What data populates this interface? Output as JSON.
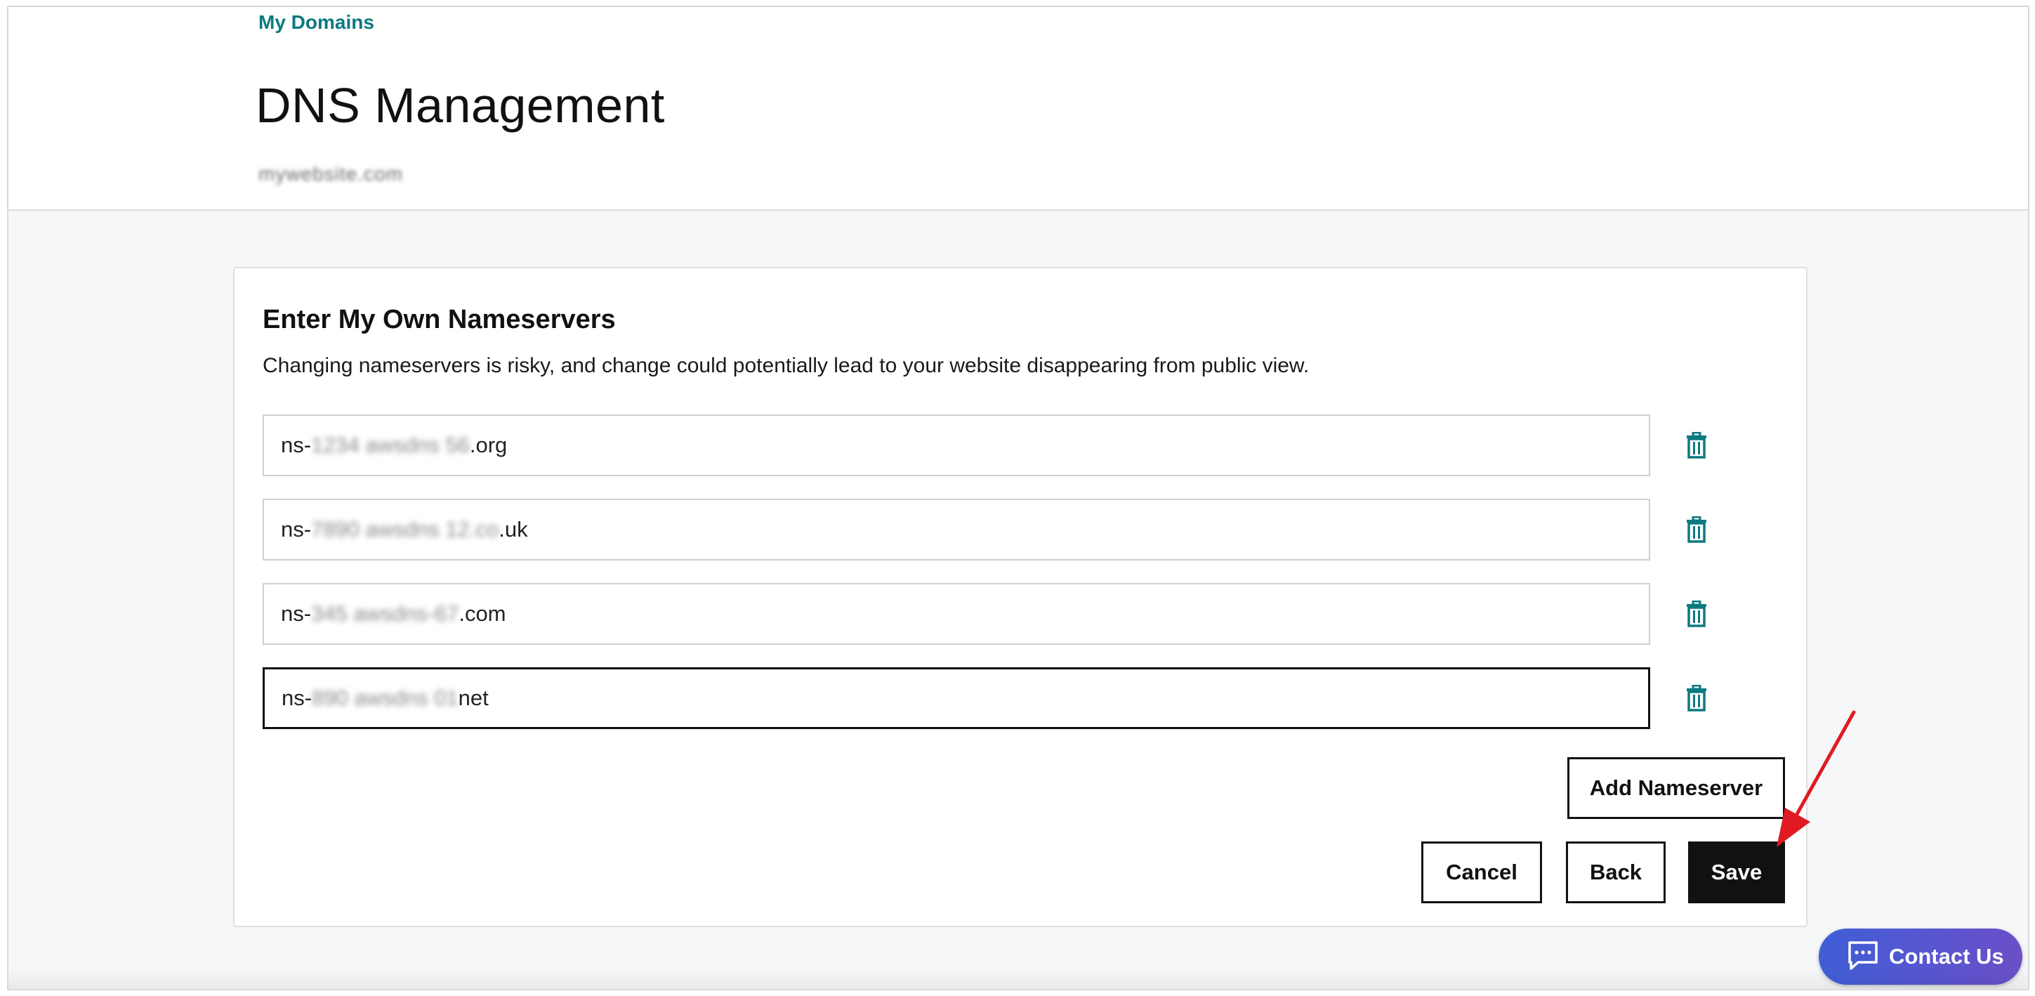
{
  "header": {
    "breadcrumb": "My Domains",
    "title": "DNS Management",
    "domain": "mywebsite.com"
  },
  "nameservers_card": {
    "title": "Enter My Own Nameservers",
    "description": "Changing nameservers is risky, and change could potentially lead to your website disappearing from public view.",
    "entries": [
      {
        "prefix": "ns-",
        "hidden": "1234 awsdns 56",
        "suffix": ".org"
      },
      {
        "prefix": "ns-",
        "hidden": "7890 awsdns 12.co",
        "suffix": ".uk"
      },
      {
        "prefix": "ns-",
        "hidden": "345 awsdns-67",
        "suffix": ".com"
      },
      {
        "prefix": "ns-",
        "hidden": "890 awsdns 01",
        "suffix": "net"
      }
    ],
    "add_label": "Add Nameserver",
    "cancel_label": "Cancel",
    "back_label": "Back",
    "save_label": "Save"
  },
  "contact": {
    "label": "Contact Us"
  },
  "colors": {
    "link": "#0b7a80",
    "icon": "#0b7a80",
    "primary_button": "#111111",
    "contact_gradient_start": "#3f5ed6",
    "contact_gradient_end": "#6b4fc8",
    "annotation_arrow": "#e01a22"
  },
  "icons": {
    "delete": "trash-icon",
    "contact": "chat-icon",
    "annotation": "red-arrow-icon"
  }
}
